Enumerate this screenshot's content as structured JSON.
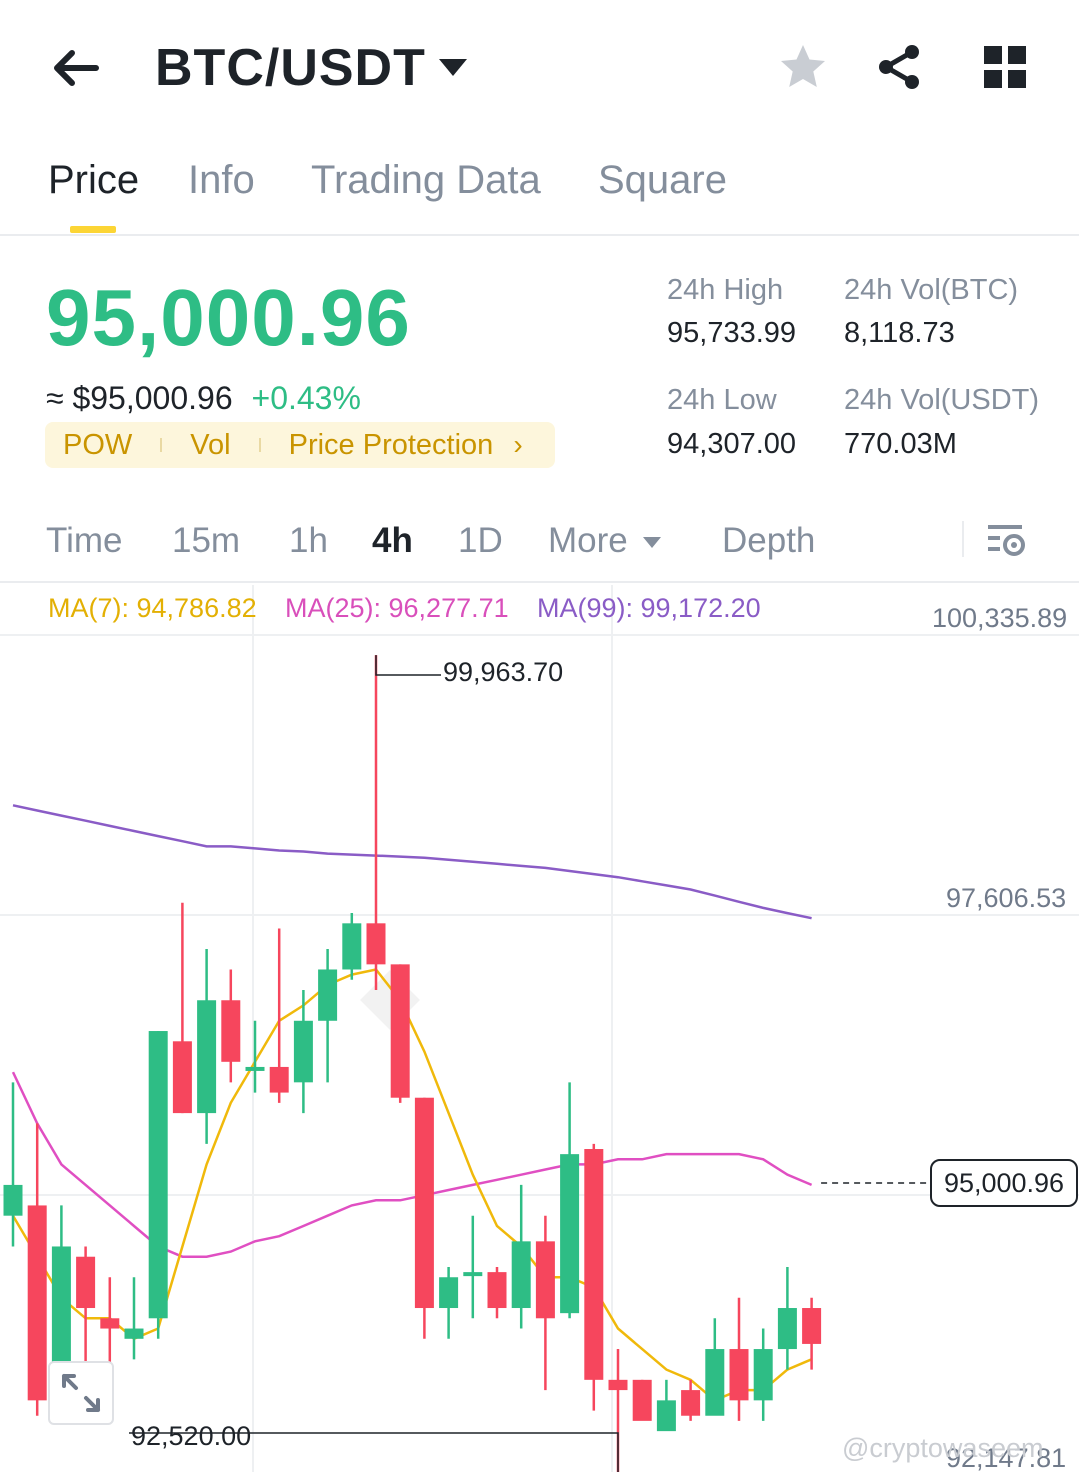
{
  "header": {
    "pair": "BTC/USDT"
  },
  "tabs": [
    {
      "label": "Price",
      "active": true
    },
    {
      "label": "Info",
      "active": false
    },
    {
      "label": "Trading Data",
      "active": false
    },
    {
      "label": "Square",
      "active": false
    }
  ],
  "price": {
    "last": "95,000.96",
    "approx_symbol": "≈",
    "fiat": "$95,000.96",
    "change_pct": "+0.43%",
    "tags": [
      "POW",
      "Vol",
      "Price Protection"
    ],
    "tag_chevron": "›"
  },
  "stats": {
    "high_label": "24h High",
    "high_value": "95,733.99",
    "vol_btc_label": "24h Vol(BTC)",
    "vol_btc_value": "8,118.73",
    "low_label": "24h Low",
    "low_value": "94,307.00",
    "vol_usdt_label": "24h Vol(USDT)",
    "vol_usdt_value": "770.03M"
  },
  "intervals": [
    {
      "label": "Time",
      "active": false
    },
    {
      "label": "15m",
      "active": false
    },
    {
      "label": "1h",
      "active": false
    },
    {
      "label": "4h",
      "active": true
    },
    {
      "label": "1D",
      "active": false
    },
    {
      "label": "More",
      "active": false
    },
    {
      "label": "Depth",
      "active": false
    }
  ],
  "ma_legend": {
    "ma7": "MA(7): 94,786.82",
    "ma25": "MA(25): 96,277.71",
    "ma99": "MA(99): 99,172.20"
  },
  "colors": {
    "up": "#2ebd85",
    "down": "#f6465d",
    "ma7": "#f0b90b",
    "ma25": "#e04fc2",
    "ma99": "#8a5cc6",
    "accent": "#fcd535"
  },
  "chart_data": {
    "type": "candlestick",
    "y_axis_labels": [
      "100,335.89",
      "97,606.53",
      "92,147.81"
    ],
    "high_marker": "99,963.70",
    "low_marker": "92,520.00",
    "current_price": "95,000.96",
    "ylim": [
      92147.81,
      100335.89
    ],
    "candles": [
      {
        "o": 94500,
        "c": 94800,
        "h": 95800,
        "l": 94200
      },
      {
        "o": 94600,
        "c": 92700,
        "h": 95400,
        "l": 92550
      },
      {
        "o": 92600,
        "c": 94200,
        "h": 94600,
        "l": 92520
      },
      {
        "o": 94100,
        "c": 93600,
        "h": 94200,
        "l": 93000
      },
      {
        "o": 93500,
        "c": 93400,
        "h": 93900,
        "l": 93000
      },
      {
        "o": 93300,
        "c": 93400,
        "h": 93900,
        "l": 93100
      },
      {
        "o": 93500,
        "c": 96300,
        "h": 96300,
        "l": 93300
      },
      {
        "o": 96200,
        "c": 95500,
        "h": 97550,
        "l": 95500
      },
      {
        "o": 95500,
        "c": 96600,
        "h": 97100,
        "l": 95200
      },
      {
        "o": 96600,
        "c": 96000,
        "h": 96900,
        "l": 95800
      },
      {
        "o": 95950,
        "c": 95950,
        "h": 96400,
        "l": 95700
      },
      {
        "o": 95950,
        "c": 95700,
        "h": 97300,
        "l": 95600
      },
      {
        "o": 95800,
        "c": 96400,
        "h": 96700,
        "l": 95500
      },
      {
        "o": 96400,
        "c": 96900,
        "h": 97100,
        "l": 95800
      },
      {
        "o": 96900,
        "c": 97350,
        "h": 97450,
        "l": 96800
      },
      {
        "o": 97350,
        "c": 96950,
        "h": 99963.7,
        "l": 96700
      },
      {
        "o": 96950,
        "c": 95650,
        "h": 96950,
        "l": 95600
      },
      {
        "o": 95650,
        "c": 93600,
        "h": 95650,
        "l": 93300
      },
      {
        "o": 93600,
        "c": 93900,
        "h": 94000,
        "l": 93300
      },
      {
        "o": 93950,
        "c": 93950,
        "h": 94500,
        "l": 93500
      },
      {
        "o": 93950,
        "c": 93600,
        "h": 94000,
        "l": 93500
      },
      {
        "o": 93600,
        "c": 94250,
        "h": 94800,
        "l": 93400
      },
      {
        "o": 94250,
        "c": 93500,
        "h": 94500,
        "l": 92800
      },
      {
        "o": 93550,
        "c": 95100,
        "h": 95800,
        "l": 93500
      },
      {
        "o": 95150,
        "c": 92900,
        "h": 95200,
        "l": 92600
      },
      {
        "o": 92900,
        "c": 92800,
        "h": 93200,
        "l": 92000
      },
      {
        "o": 92900,
        "c": 92500,
        "h": 92900,
        "l": 92600
      },
      {
        "o": 92400,
        "c": 92700,
        "h": 92900,
        "l": 92500
      },
      {
        "o": 92800,
        "c": 92550,
        "h": 92900,
        "l": 92500
      },
      {
        "o": 92550,
        "c": 93200,
        "h": 93500,
        "l": 92800
      },
      {
        "o": 93200,
        "c": 92700,
        "h": 93700,
        "l": 92500
      },
      {
        "o": 92700,
        "c": 93200,
        "h": 93400,
        "l": 92500
      },
      {
        "o": 93200,
        "c": 93600,
        "h": 94000,
        "l": 93000
      },
      {
        "o": 93600,
        "c": 93250,
        "h": 93700,
        "l": 93000
      }
    ],
    "ma7": [
      94500,
      94100,
      93700,
      93500,
      93500,
      93300,
      93400,
      94200,
      95000,
      95600,
      96000,
      96400,
      96550,
      96750,
      96850,
      96900,
      96600,
      96100,
      95500,
      94900,
      94400,
      94200,
      93900,
      93900,
      93800,
      93400,
      93200,
      93000,
      92900,
      92700,
      92800,
      92800,
      93000,
      93100
    ],
    "ma25": [
      95900,
      95400,
      95000,
      94800,
      94600,
      94400,
      94200,
      94100,
      94100,
      94150,
      94250,
      94300,
      94400,
      94500,
      94600,
      94650,
      94650,
      94700,
      94750,
      94800,
      94850,
      94900,
      94950,
      95000,
      95000,
      95050,
      95050,
      95100,
      95100,
      95100,
      95100,
      95050,
      94900,
      94800
    ],
    "ma99": [
      98500,
      98450,
      98400,
      98350,
      98300,
      98250,
      98200,
      98150,
      98100,
      98100,
      98080,
      98060,
      98050,
      98030,
      98020,
      98010,
      98000,
      97990,
      97970,
      97950,
      97930,
      97910,
      97890,
      97860,
      97830,
      97800,
      97760,
      97720,
      97680,
      97620,
      97560,
      97500,
      97450,
      97400
    ]
  },
  "watermark": "@cryptowaseem"
}
